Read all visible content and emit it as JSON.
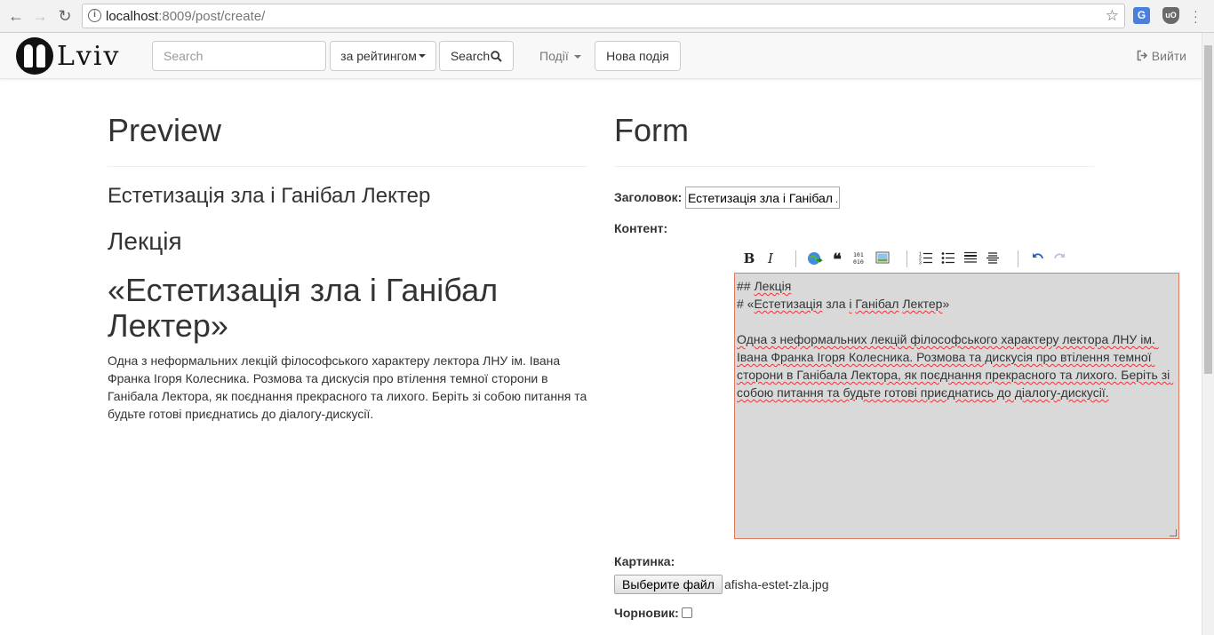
{
  "browser": {
    "url_host": "localhost",
    "url_rest": ":8009/post/create/"
  },
  "navbar": {
    "logo_text": "Lviv",
    "search": {
      "placeholder": "Search",
      "value": ""
    },
    "sort_dropdown_label": "за рейтингом",
    "search_button_label": "Search",
    "events_dropdown_label": "Події",
    "new_event_button_label": "Нова подія",
    "logout_label": "Вийти"
  },
  "preview": {
    "heading": "Preview",
    "title": "Естетизація зла і Ганібал Лектер",
    "h2": "Лекція",
    "h1": "«Естетизація зла і Ганібал Лектер»",
    "paragraph": "Одна з неформальних лекцій філософського характеру лектора ЛНУ ім. Івана Франка Ігоря Колесника. Розмова та дискусія про втілення темної сторони в Ганібала Лектора, як поєднання прекрасного та лихого. Беріть зі собою питання та будьте готові приєднатись до діалогу-дискусії."
  },
  "form": {
    "heading": "Form",
    "title_label": "Заголовок:",
    "title_value": "Естетизація зла і Ганібал Лектер",
    "content_label": "Контент:",
    "editor": {
      "line1_prefix": "## ",
      "line1_word": "Лекція",
      "line2_prefix": "# «",
      "line2_w1": "Естетизація",
      "line2_w2": " зла ",
      "line2_w3": "і",
      "line2_w4": " ",
      "line2_w5": "Ганібал",
      "line2_w6": " ",
      "line2_w7": "Лектер",
      "line2_suffix": "»",
      "paragraph": "Одна з неформальних лекцій філософського характеру лектора ЛНУ ім. Івана Франка Ігоря Колесника. Розмова та дискусія про втілення темної сторони в Ганібала Лектора, як поєднання прекрасного та лихого. Беріть зі собою питання та будьте готові приєднатись до діалогу-дискусії."
    },
    "toolbar": {
      "bold": "B",
      "italic": "I",
      "quote": "❝"
    },
    "image_label": "Картинка:",
    "file_button_label": "Выберите файл",
    "file_name": "afisha-estet-zla.jpg",
    "draft_label": "Чорновик:",
    "draft_checked": false
  }
}
